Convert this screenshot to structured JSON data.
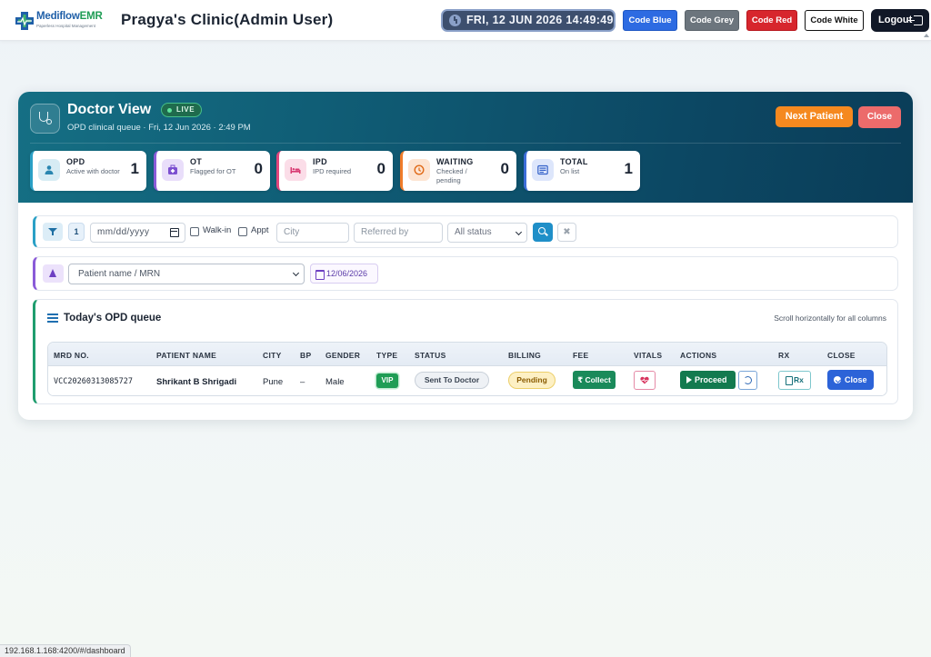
{
  "header": {
    "logo_text_main": "Mediflow",
    "logo_text_emr": "EMR",
    "logo_tagline": "Paperless Hospital Management",
    "clinic_title": "Pragya's Clinic(Admin User)",
    "datetime": "FRI, 12 JUN 2026 14:49:49",
    "code_buttons": [
      "Code Blue",
      "Code Grey",
      "Code Red",
      "Code White"
    ],
    "logout_label": "Logout",
    "colors": {
      "code_blue": "#2d6be2",
      "code_grey": "#6c757d",
      "code_red": "#d7262d",
      "code_white": "#ffffff"
    }
  },
  "hero": {
    "title": "Doctor View",
    "live_badge": "LIVE",
    "subtitle": "OPD clinical queue · Fri, 12 Jun 2026 · 2:49 PM",
    "next_patient_label": "Next Patient",
    "close_label": "Close",
    "stats": [
      {
        "label": "OPD",
        "desc": "Active with doctor",
        "value": "1",
        "icon": "user-md-icon"
      },
      {
        "label": "OT",
        "desc": "Flagged for OT",
        "value": "0",
        "icon": "medical-kit-icon"
      },
      {
        "label": "IPD",
        "desc": "IPD required",
        "value": "0",
        "icon": "bed-icon"
      },
      {
        "label": "WAITING",
        "desc": "Checked / pending",
        "value": "0",
        "icon": "clock-icon"
      },
      {
        "label": "TOTAL",
        "desc": "On list",
        "value": "1",
        "icon": "list-card-icon"
      }
    ]
  },
  "filters": {
    "count": "1",
    "date_placeholder": "mm/dd/yyyy",
    "walkin_label": "Walk-in",
    "appt_label": "Appt",
    "city_placeholder": "City",
    "referred_placeholder": "Referred by",
    "status_selected": "All status",
    "clear_symbol": "✖"
  },
  "patient_picker": {
    "placeholder": "Patient name / MRN",
    "date": "12/06/2026"
  },
  "queue": {
    "title": "Today's OPD queue",
    "hint": "Scroll horizontally for all columns",
    "columns": [
      "MRD NO.",
      "PATIENT NAME",
      "CITY",
      "BP",
      "GENDER",
      "TYPE",
      "STATUS",
      "BILLING",
      "FEE",
      "VITALS",
      "ACTIONS",
      "RX",
      "CLOSE"
    ],
    "rows": [
      {
        "mrd": "VCC20260313085727",
        "name": "Shrikant B Shrigadi",
        "city": "Pune",
        "bp": "–",
        "gender": "Male",
        "type": "VIP",
        "status": "Sent To Doctor",
        "billing": "Pending",
        "fee_action": "₹ Collect",
        "proceed_label": "Proceed",
        "rx_label": "Rx",
        "close_label": "Close"
      }
    ]
  },
  "status_bar_url": "192.168.1.168:4200/#/dashboard"
}
